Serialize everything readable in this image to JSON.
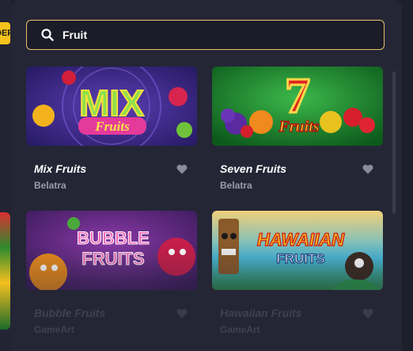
{
  "background": {
    "deposit_label": "DEPOSIT"
  },
  "search": {
    "value": "Fruit",
    "icon": "search-icon"
  },
  "results": [
    {
      "title": "Mix Fruits",
      "provider": "Belatra",
      "favorite_icon": "heart-icon",
      "art_text": [
        "MIX",
        "Fruits"
      ]
    },
    {
      "title": "Seven Fruits",
      "provider": "Belatra",
      "favorite_icon": "heart-icon",
      "art_text": [
        "7",
        "Fruits"
      ]
    },
    {
      "title": "Bubble Fruits",
      "provider": "GameArt",
      "favorite_icon": "heart-icon",
      "art_text": [
        "BUBBLE",
        "FRUITS"
      ]
    },
    {
      "title": "Hawaiian Fruits",
      "provider": "GameArt",
      "favorite_icon": "heart-icon",
      "art_text": [
        "HAWAIIAN",
        "FRUITS"
      ]
    }
  ],
  "colors": {
    "accent_border": "#e9c06a",
    "panel_bg": "#242636",
    "provider_text": "#9a9cae"
  }
}
